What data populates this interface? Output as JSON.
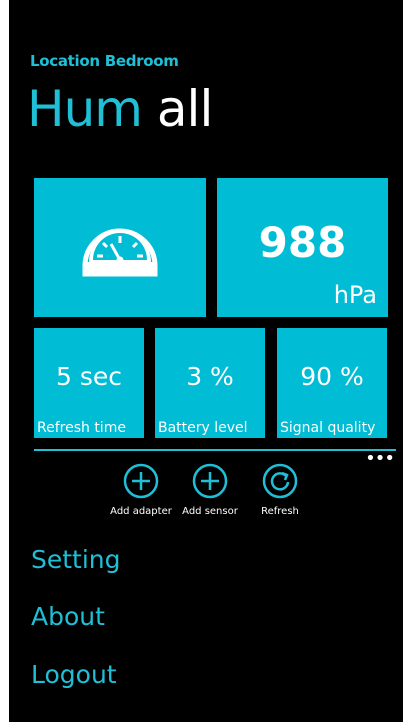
{
  "header": {
    "location": "Location Bedroom",
    "pivot_active": "Hum",
    "pivot_other": "all"
  },
  "tiles": {
    "gauge_icon": "gauge-icon",
    "pressure_value": "988",
    "pressure_unit": "hPa",
    "refresh": {
      "value": "5 sec",
      "label": "Refresh time"
    },
    "battery": {
      "value": "3 %",
      "label": "Battery level"
    },
    "signal": {
      "value": "90 %",
      "label": "Signal quality"
    }
  },
  "appbar": {
    "more": "•••",
    "buttons": [
      {
        "label": "Add adapter",
        "icon": "plus-circle-icon"
      },
      {
        "label": "Add sensor",
        "icon": "plus-circle-icon"
      },
      {
        "label": "Refresh",
        "icon": "refresh-icon"
      }
    ]
  },
  "menu": {
    "items": [
      "Setting",
      "About",
      "Logout"
    ]
  },
  "colors": {
    "accent": "#1fbfd6",
    "tile": "#00bcd4",
    "background": "#000000"
  }
}
